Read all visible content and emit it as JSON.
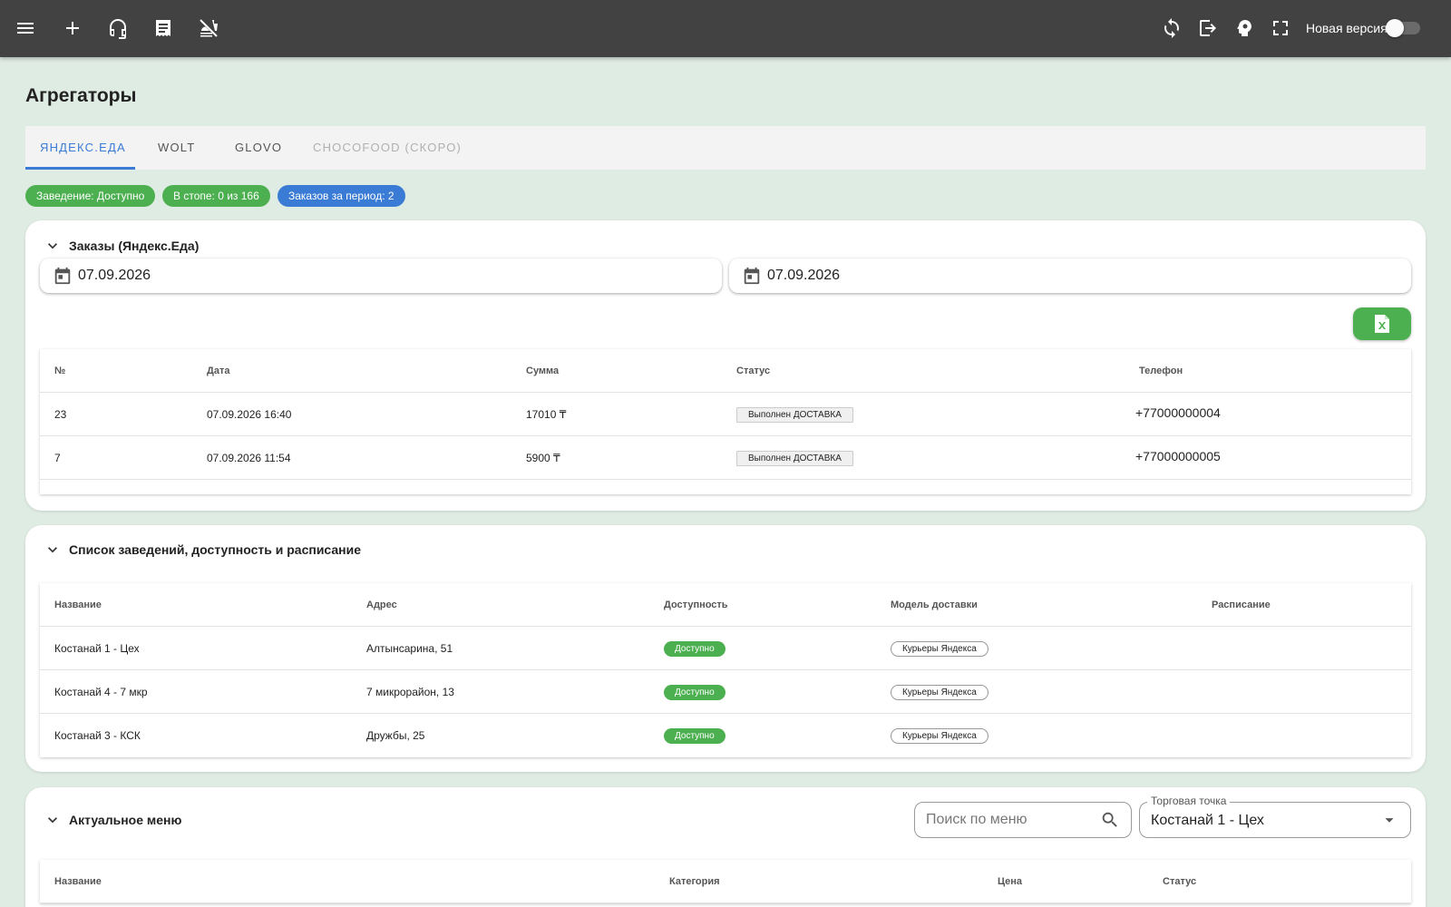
{
  "topbar": {
    "icons": {
      "menu": "menu-icon",
      "add": "plus-icon",
      "support": "headset-icon",
      "receipt": "receipt-icon",
      "no_food": "no-food-icon",
      "sync": "sync-icon",
      "logout": "logout-icon",
      "psychology": "brain-icon",
      "fullscreen": "fullscreen-icon"
    },
    "new_version_label": "Новая версия",
    "new_version_on": false
  },
  "page": {
    "title": "Агрегаторы"
  },
  "tabs": [
    {
      "label": "ЯНДЕКС.ЕДА",
      "active": true
    },
    {
      "label": "WOLT",
      "active": false
    },
    {
      "label": "GLOVO",
      "active": false
    },
    {
      "label": "CHOCOFOOD (СКОРО)",
      "active": false,
      "disabled": true
    }
  ],
  "chips": {
    "venue": "Заведение: Доступно",
    "stop": "В стопе: 0 из 166",
    "orders": "Заказов за период: 2"
  },
  "orders": {
    "title": "Заказы (Яндекс.Еда)",
    "date_from": "07.09.2026",
    "date_to": "07.09.2026",
    "columns": [
      "№",
      "Дата",
      "Сумма",
      "Статус",
      "Телефон"
    ],
    "rows": [
      {
        "num": "23",
        "date": "07.09.2026 16:40",
        "sum": "17010 ₸",
        "status": "Выполнен ДОСТАВКА",
        "phone": "+77000000004"
      },
      {
        "num": "7",
        "date": "07.09.2026 11:54",
        "sum": "5900 ₸",
        "status": "Выполнен ДОСТАВКА",
        "phone": "+77000000005"
      }
    ]
  },
  "venues": {
    "title": "Список заведений, доступность и расписание",
    "columns": [
      "Название",
      "Адрес",
      "Доступность",
      "Модель доставки",
      "Расписание"
    ],
    "rows": [
      {
        "name": "Костанай 1 - Цех",
        "address": "Алтынсарина, 51",
        "availability": "Доступно",
        "model": "Курьеры Яндекса"
      },
      {
        "name": "Костанай 4 - 7 мкр",
        "address": "7 микрорайон, 13",
        "availability": "Доступно",
        "model": "Курьеры Яндекса"
      },
      {
        "name": "Костанай 3 - КСК",
        "address": "Дружбы, 25",
        "availability": "Доступно",
        "model": "Курьеры Яндекса"
      }
    ]
  },
  "menu": {
    "title": "Актуальное меню",
    "search_placeholder": "Поиск по меню",
    "point_label": "Торговая точка",
    "point_value": "Костанай 1 - Цех",
    "columns": [
      "Название",
      "Категория",
      "Цена",
      "Статус"
    ]
  },
  "colors": {
    "topbar": "#424242",
    "background": "#dfece4",
    "accent": "#3a7bd5",
    "success": "#4caf50"
  }
}
